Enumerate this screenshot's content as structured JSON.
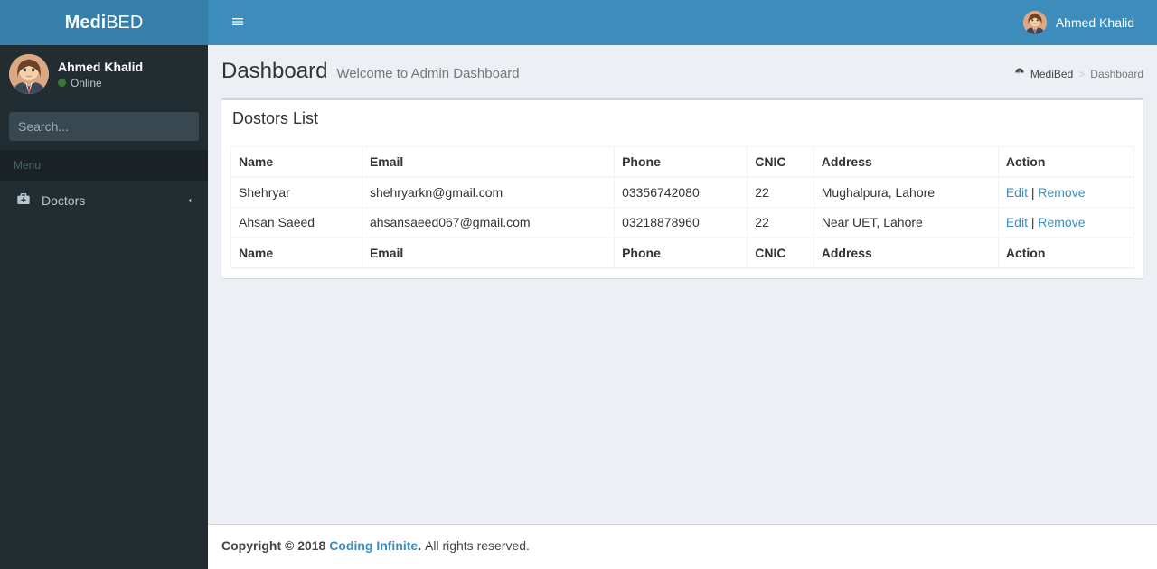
{
  "brand": {
    "part1": "Medi",
    "part2": "BED"
  },
  "header": {
    "user_name": "Ahmed Khalid"
  },
  "sidebar": {
    "user_name": "Ahmed Khalid",
    "status_text": "Online",
    "search_placeholder": "Search...",
    "menu_label": "Menu",
    "items": [
      {
        "label": "Doctors"
      }
    ]
  },
  "page": {
    "title": "Dashboard",
    "subtitle": "Welcome to Admin Dashboard"
  },
  "breadcrumb": {
    "home": "MediBed",
    "current": "Dashboard"
  },
  "card": {
    "title": "Dostors List",
    "columns": {
      "name": "Name",
      "email": "Email",
      "phone": "Phone",
      "cnic": "CNIC",
      "address": "Address",
      "action": "Action"
    },
    "rows": [
      {
        "name": "Shehryar",
        "email": "shehryarkn@gmail.com",
        "phone": "03356742080",
        "cnic": "22",
        "address": "Mughalpura, Lahore"
      },
      {
        "name": "Ahsan Saeed",
        "email": "ahsansaeed067@gmail.com",
        "phone": "03218878960",
        "cnic": "22",
        "address": "Near UET, Lahore"
      }
    ],
    "actions": {
      "edit": "Edit",
      "remove": "Remove",
      "sep": " | "
    }
  },
  "footer": {
    "prefix": "Copyright © 2018 ",
    "link": "Coding Infinite",
    "dot": ".",
    "suffix": " All rights reserved."
  }
}
